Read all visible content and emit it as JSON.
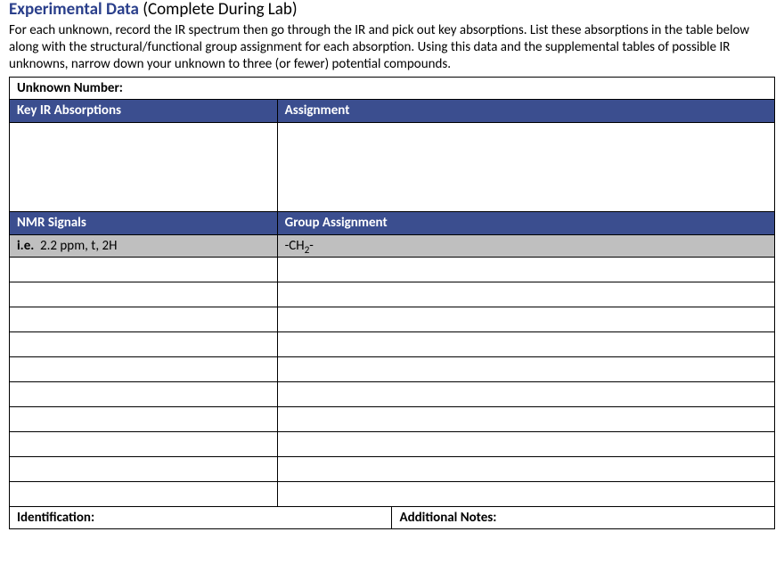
{
  "heading": {
    "title": "Experimental Data",
    "subtitle": "(Complete During Lab)"
  },
  "intro": "For each unknown, record the IR spectrum then go through the IR and pick out key absorptions. List these absorptions in the table below along with the structural/functional group assignment for each absorption. Using this data and the supplemental tables of possible IR unknowns, narrow down your unknown to three (or fewer) potential compounds.",
  "table": {
    "unknown_label": "Unknown Number:",
    "ir_header_left": "Key IR Absorptions",
    "ir_header_right": "Assignment",
    "nmr_header_left": "NMR Signals",
    "nmr_header_right": "Group Assignment",
    "example": {
      "prefix": "i.e.",
      "signal": "2.2 ppm, t, 2H",
      "assignment_pre": "-CH",
      "assignment_sub": "2",
      "assignment_post": "-"
    },
    "identification_label": "Identification:",
    "notes_label": "Additional Notes:"
  }
}
